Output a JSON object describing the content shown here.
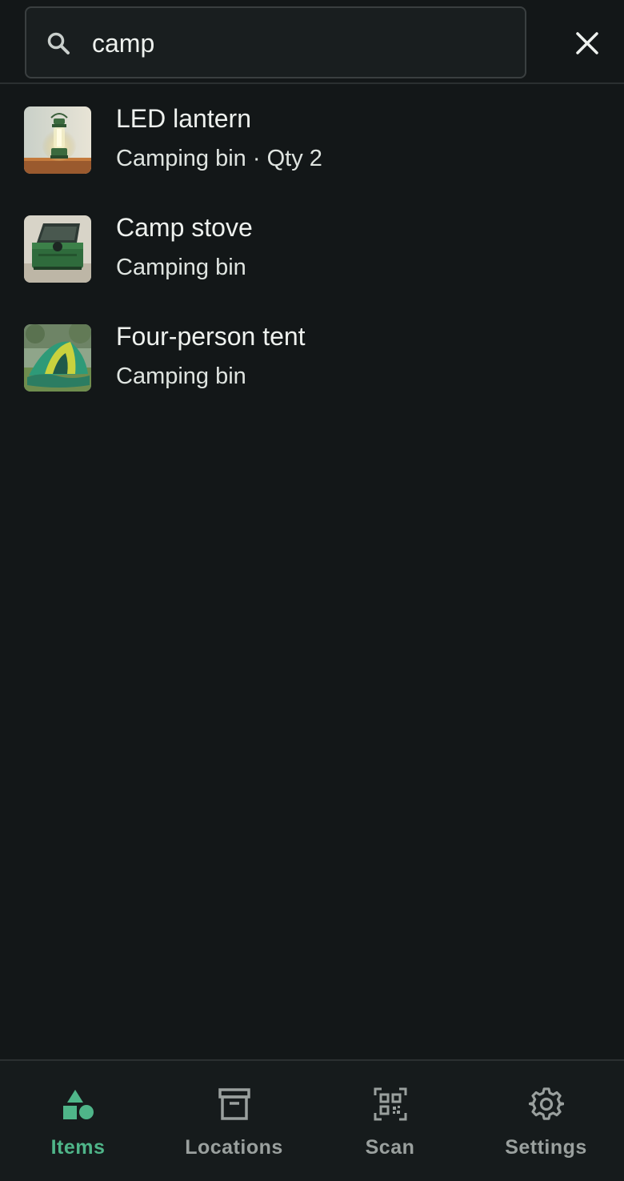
{
  "search": {
    "value": "camp",
    "placeholder": "",
    "search_icon": "search-icon",
    "clear_icon": "close-icon"
  },
  "results": [
    {
      "title": "LED lantern",
      "subtitle": "Camping bin · Qty 2",
      "thumbnail": "lantern-photo"
    },
    {
      "title": "Camp stove",
      "subtitle": "Camping bin",
      "thumbnail": "stove-photo"
    },
    {
      "title": "Four-person tent",
      "subtitle": "Camping bin",
      "thumbnail": "tent-photo"
    }
  ],
  "nav": {
    "items": [
      {
        "label": "Items",
        "icon": "shapes-icon",
        "active": true
      },
      {
        "label": "Locations",
        "icon": "archive-box-icon",
        "active": false
      },
      {
        "label": "Scan",
        "icon": "qr-code-icon",
        "active": false
      },
      {
        "label": "Settings",
        "icon": "gear-icon",
        "active": false
      }
    ]
  },
  "colors": {
    "background": "#131718",
    "accent": "#4fb589",
    "inactive": "#9aa09e",
    "text": "#eef1ee"
  }
}
